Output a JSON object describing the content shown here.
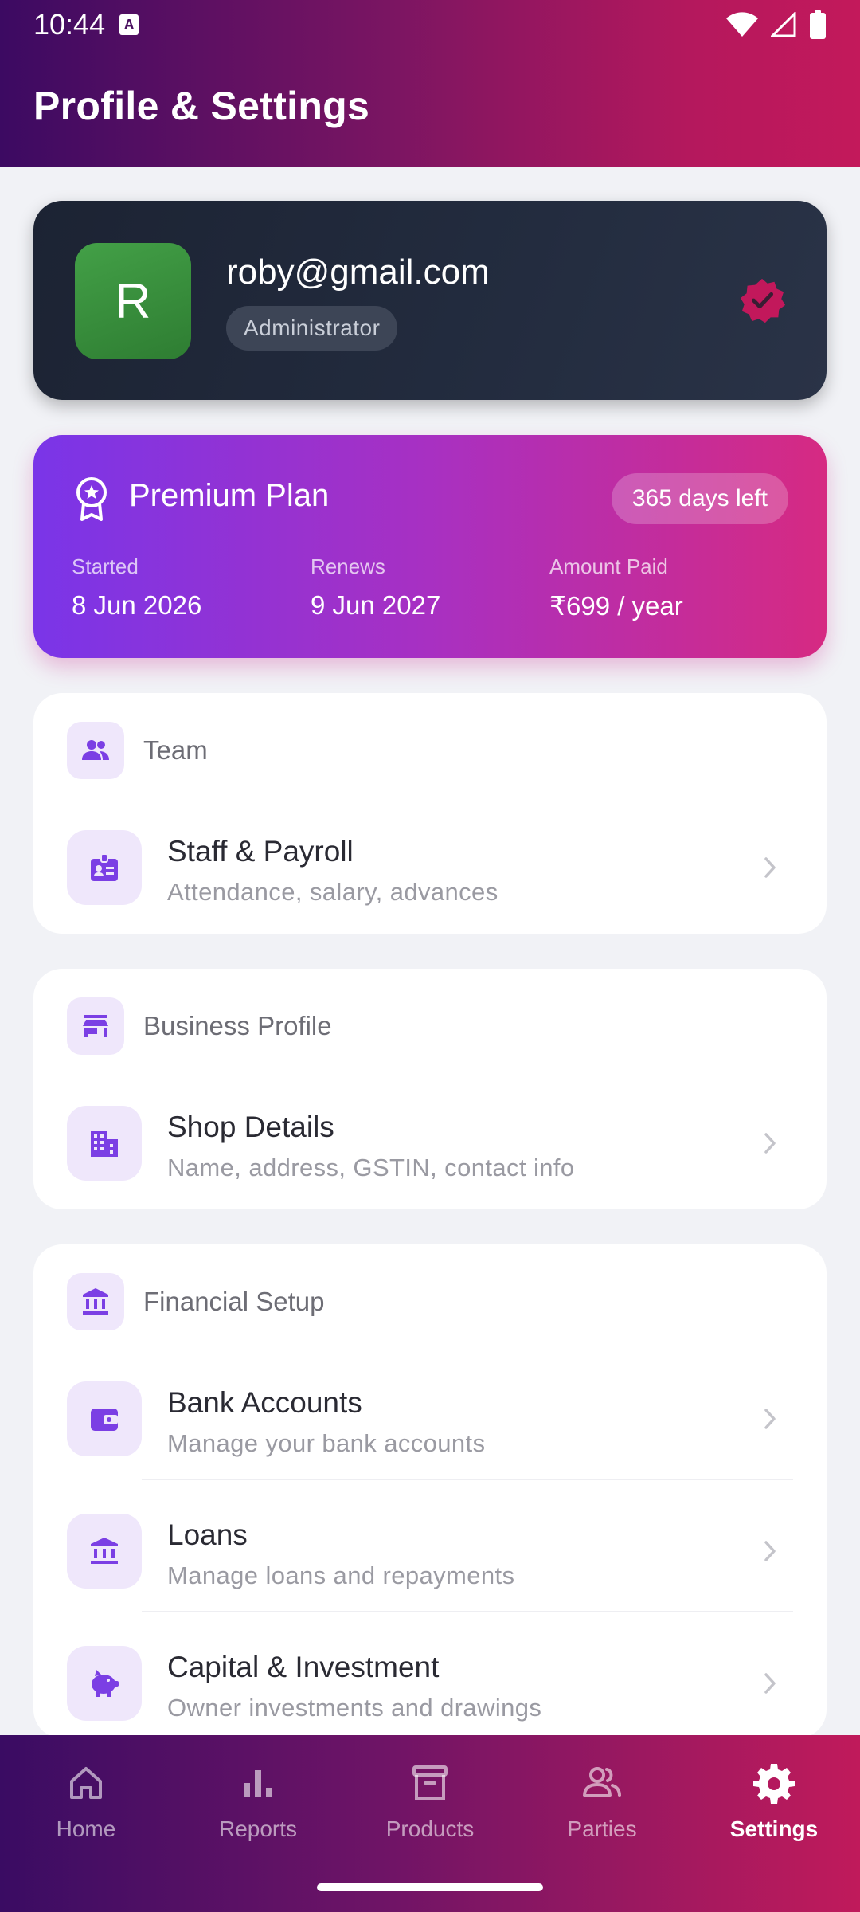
{
  "status_bar": {
    "time": "10:44"
  },
  "header": {
    "title": "Profile & Settings"
  },
  "profile": {
    "avatar_letter": "R",
    "email": "roby@gmail.com",
    "role": "Administrator",
    "avatar_color": "#43a047",
    "verified_color": "#c2185b"
  },
  "plan": {
    "name": "Premium Plan",
    "days_left": "365 days left",
    "started_label": "Started",
    "started_value": "8 Jun 2026",
    "renews_label": "Renews",
    "renews_value": "9 Jun 2027",
    "paid_label": "Amount Paid",
    "paid_value": "₹699 / year"
  },
  "sections": {
    "team": {
      "title": "Team",
      "items": [
        {
          "title": "Staff & Payroll",
          "subtitle": "Attendance, salary, advances",
          "icon": "badge-icon"
        }
      ]
    },
    "business": {
      "title": "Business Profile",
      "items": [
        {
          "title": "Shop Details",
          "subtitle": "Name, address, GSTIN, contact info",
          "icon": "building-icon"
        }
      ]
    },
    "financial": {
      "title": "Financial Setup",
      "items": [
        {
          "title": "Bank Accounts",
          "subtitle": "Manage your bank accounts",
          "icon": "wallet-icon"
        },
        {
          "title": "Loans",
          "subtitle": "Manage loans and repayments",
          "icon": "bank-icon"
        },
        {
          "title": "Capital & Investment",
          "subtitle": "Owner investments and drawings",
          "icon": "piggy-bank-icon"
        }
      ]
    }
  },
  "nav": {
    "items": [
      {
        "label": "Home",
        "icon": "home-icon"
      },
      {
        "label": "Reports",
        "icon": "bar-chart-icon"
      },
      {
        "label": "Products",
        "icon": "archive-box-icon"
      },
      {
        "label": "Parties",
        "icon": "people-icon"
      },
      {
        "label": "Settings",
        "icon": "gear-icon"
      }
    ],
    "active": "Settings"
  },
  "colors": {
    "accent": "#7b3fe4",
    "icon_bg": "#efe7fb",
    "header_start": "#3c0a62",
    "header_end": "#c3195b"
  }
}
